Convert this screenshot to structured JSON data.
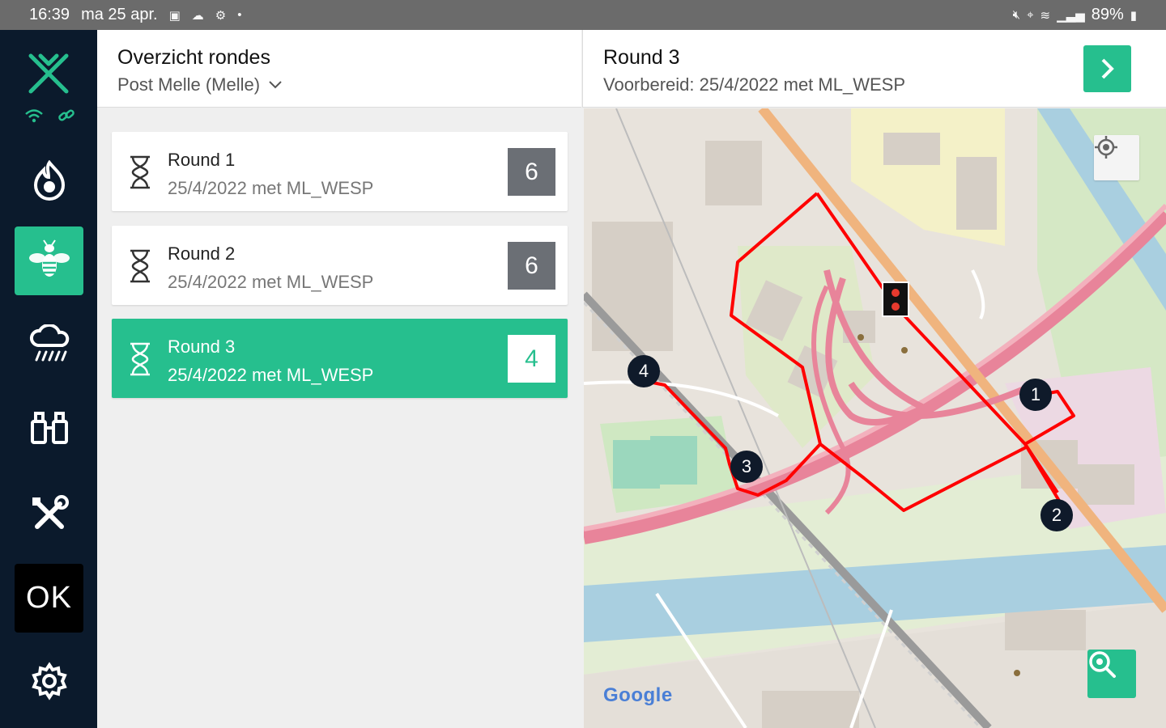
{
  "status_bar": {
    "time": "16:39",
    "date": "ma 25 apr.",
    "battery": "89%"
  },
  "rail": {
    "ok_label": "OK"
  },
  "list_header": {
    "title": "Overzicht rondes",
    "location": "Post Melle (Melle)"
  },
  "rounds": [
    {
      "name": "Round 1",
      "date": "25/4/2022 met ML_WESP",
      "count": "6",
      "selected": false
    },
    {
      "name": "Round 2",
      "date": "25/4/2022 met ML_WESP",
      "count": "6",
      "selected": false
    },
    {
      "name": "Round 3",
      "date": "25/4/2022 met ML_WESP",
      "count": "4",
      "selected": true
    }
  ],
  "detail": {
    "title": "Round 3",
    "subtitle": "Voorbereid: 25/4/2022 met ML_WESP"
  },
  "map": {
    "waypoints": [
      "1",
      "2",
      "3",
      "4"
    ],
    "attribution": "Google"
  },
  "colors": {
    "accent": "#26bf8e",
    "rail": "#0b1a2c",
    "route": "#ff0000",
    "highway": "#e8849a",
    "water": "#9ec8dc"
  }
}
